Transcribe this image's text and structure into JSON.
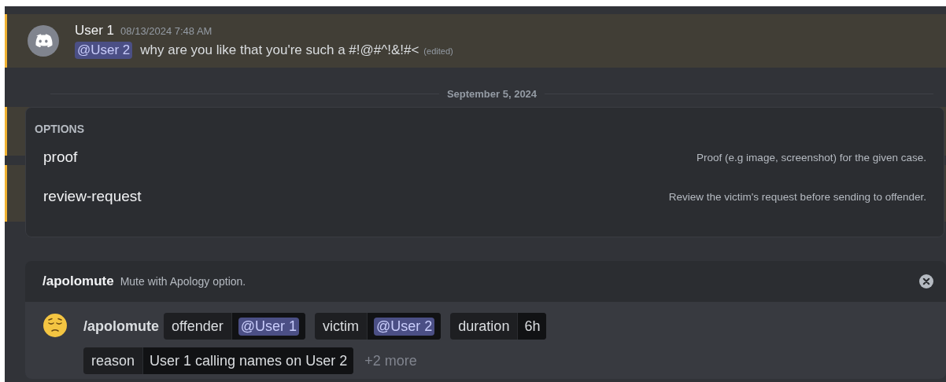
{
  "message": {
    "author": "User 1",
    "timestamp": "08/13/2024 7:48 AM",
    "mention": "@User 2",
    "text": "why are you like that you're such a #!@#^!&!#<",
    "edited": "(edited)",
    "highlighted": true
  },
  "date_divider": "September 5, 2024",
  "options_popup": {
    "title": "OPTIONS",
    "items": [
      {
        "name": "proof",
        "description": "Proof (e.g image, screenshot) for the given case."
      },
      {
        "name": "review-request",
        "description": "Review the victim's request before sending to offender."
      }
    ]
  },
  "command": {
    "name": "/apolomute",
    "description": "Mute with Apology option.",
    "input_command": "/apolomute",
    "params": [
      {
        "name": "offender",
        "value": "@User 1",
        "kind": "mention"
      },
      {
        "name": "victim",
        "value": "@User 2",
        "kind": "mention"
      },
      {
        "name": "duration",
        "value": "6h",
        "kind": "text"
      },
      {
        "name": "reason",
        "value": "User 1 calling names on User 2",
        "kind": "text"
      }
    ],
    "more": "+2 more"
  }
}
